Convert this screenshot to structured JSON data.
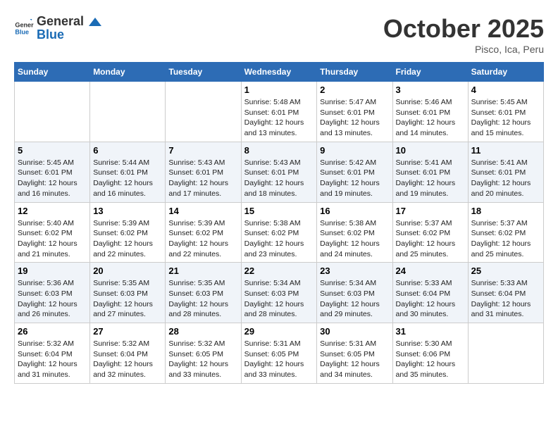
{
  "logo": {
    "general": "General",
    "blue": "Blue"
  },
  "title": {
    "month_year": "October 2025",
    "location": "Pisco, Ica, Peru"
  },
  "headers": [
    "Sunday",
    "Monday",
    "Tuesday",
    "Wednesday",
    "Thursday",
    "Friday",
    "Saturday"
  ],
  "weeks": [
    [
      {
        "day": "",
        "content": ""
      },
      {
        "day": "",
        "content": ""
      },
      {
        "day": "",
        "content": ""
      },
      {
        "day": "1",
        "content": "Sunrise: 5:48 AM\nSunset: 6:01 PM\nDaylight: 12 hours and 13 minutes."
      },
      {
        "day": "2",
        "content": "Sunrise: 5:47 AM\nSunset: 6:01 PM\nDaylight: 12 hours and 13 minutes."
      },
      {
        "day": "3",
        "content": "Sunrise: 5:46 AM\nSunset: 6:01 PM\nDaylight: 12 hours and 14 minutes."
      },
      {
        "day": "4",
        "content": "Sunrise: 5:45 AM\nSunset: 6:01 PM\nDaylight: 12 hours and 15 minutes."
      }
    ],
    [
      {
        "day": "5",
        "content": "Sunrise: 5:45 AM\nSunset: 6:01 PM\nDaylight: 12 hours and 16 minutes."
      },
      {
        "day": "6",
        "content": "Sunrise: 5:44 AM\nSunset: 6:01 PM\nDaylight: 12 hours and 16 minutes."
      },
      {
        "day": "7",
        "content": "Sunrise: 5:43 AM\nSunset: 6:01 PM\nDaylight: 12 hours and 17 minutes."
      },
      {
        "day": "8",
        "content": "Sunrise: 5:43 AM\nSunset: 6:01 PM\nDaylight: 12 hours and 18 minutes."
      },
      {
        "day": "9",
        "content": "Sunrise: 5:42 AM\nSunset: 6:01 PM\nDaylight: 12 hours and 19 minutes."
      },
      {
        "day": "10",
        "content": "Sunrise: 5:41 AM\nSunset: 6:01 PM\nDaylight: 12 hours and 19 minutes."
      },
      {
        "day": "11",
        "content": "Sunrise: 5:41 AM\nSunset: 6:01 PM\nDaylight: 12 hours and 20 minutes."
      }
    ],
    [
      {
        "day": "12",
        "content": "Sunrise: 5:40 AM\nSunset: 6:02 PM\nDaylight: 12 hours and 21 minutes."
      },
      {
        "day": "13",
        "content": "Sunrise: 5:39 AM\nSunset: 6:02 PM\nDaylight: 12 hours and 22 minutes."
      },
      {
        "day": "14",
        "content": "Sunrise: 5:39 AM\nSunset: 6:02 PM\nDaylight: 12 hours and 22 minutes."
      },
      {
        "day": "15",
        "content": "Sunrise: 5:38 AM\nSunset: 6:02 PM\nDaylight: 12 hours and 23 minutes."
      },
      {
        "day": "16",
        "content": "Sunrise: 5:38 AM\nSunset: 6:02 PM\nDaylight: 12 hours and 24 minutes."
      },
      {
        "day": "17",
        "content": "Sunrise: 5:37 AM\nSunset: 6:02 PM\nDaylight: 12 hours and 25 minutes."
      },
      {
        "day": "18",
        "content": "Sunrise: 5:37 AM\nSunset: 6:02 PM\nDaylight: 12 hours and 25 minutes."
      }
    ],
    [
      {
        "day": "19",
        "content": "Sunrise: 5:36 AM\nSunset: 6:03 PM\nDaylight: 12 hours and 26 minutes."
      },
      {
        "day": "20",
        "content": "Sunrise: 5:35 AM\nSunset: 6:03 PM\nDaylight: 12 hours and 27 minutes."
      },
      {
        "day": "21",
        "content": "Sunrise: 5:35 AM\nSunset: 6:03 PM\nDaylight: 12 hours and 28 minutes."
      },
      {
        "day": "22",
        "content": "Sunrise: 5:34 AM\nSunset: 6:03 PM\nDaylight: 12 hours and 28 minutes."
      },
      {
        "day": "23",
        "content": "Sunrise: 5:34 AM\nSunset: 6:03 PM\nDaylight: 12 hours and 29 minutes."
      },
      {
        "day": "24",
        "content": "Sunrise: 5:33 AM\nSunset: 6:04 PM\nDaylight: 12 hours and 30 minutes."
      },
      {
        "day": "25",
        "content": "Sunrise: 5:33 AM\nSunset: 6:04 PM\nDaylight: 12 hours and 31 minutes."
      }
    ],
    [
      {
        "day": "26",
        "content": "Sunrise: 5:32 AM\nSunset: 6:04 PM\nDaylight: 12 hours and 31 minutes."
      },
      {
        "day": "27",
        "content": "Sunrise: 5:32 AM\nSunset: 6:04 PM\nDaylight: 12 hours and 32 minutes."
      },
      {
        "day": "28",
        "content": "Sunrise: 5:32 AM\nSunset: 6:05 PM\nDaylight: 12 hours and 33 minutes."
      },
      {
        "day": "29",
        "content": "Sunrise: 5:31 AM\nSunset: 6:05 PM\nDaylight: 12 hours and 33 minutes."
      },
      {
        "day": "30",
        "content": "Sunrise: 5:31 AM\nSunset: 6:05 PM\nDaylight: 12 hours and 34 minutes."
      },
      {
        "day": "31",
        "content": "Sunrise: 5:30 AM\nSunset: 6:06 PM\nDaylight: 12 hours and 35 minutes."
      },
      {
        "day": "",
        "content": ""
      }
    ]
  ]
}
